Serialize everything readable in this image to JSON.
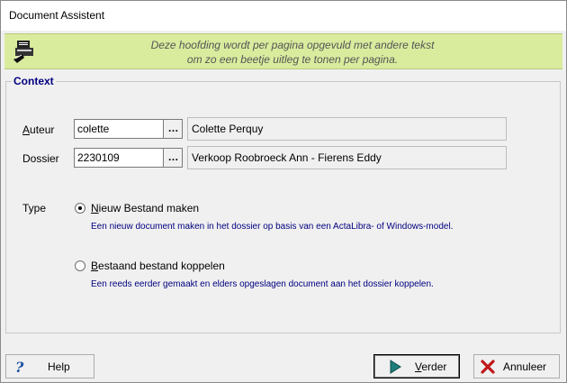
{
  "window": {
    "title": "Document Assistent"
  },
  "header": {
    "line1": "Deze hoofding wordt per pagina opgevuld met andere tekst",
    "line2": "om zo een beetje uitleg te tonen per pagina."
  },
  "context": {
    "legend": "Context",
    "auteur": {
      "label_hot": "A",
      "label_rest": "uteur",
      "value": "colette",
      "name": "Colette Perquy"
    },
    "dossier": {
      "label": "Dossier",
      "value": "2230109",
      "name": "Verkoop Roobroeck Ann - Fierens Eddy"
    },
    "ellipsis": "…",
    "type_label": "Type",
    "options": [
      {
        "hot": "N",
        "rest": "ieuw Bestand maken",
        "description": "Een nieuw document maken in het dossier op basis van een ActaLibra- of Windows-model.",
        "checked": true
      },
      {
        "hot": "B",
        "rest": "estaand bestand koppelen",
        "description": "Een reeds eerder gemaakt en elders opgeslagen document aan het dossier koppelen.",
        "checked": false
      }
    ]
  },
  "buttons": {
    "help": "Help",
    "next_hot": "V",
    "next_rest": "erder",
    "cancel": "Annuleer"
  },
  "colors": {
    "header_band": "#d9ec9e",
    "legend": "#000080",
    "desc": "#000080"
  }
}
